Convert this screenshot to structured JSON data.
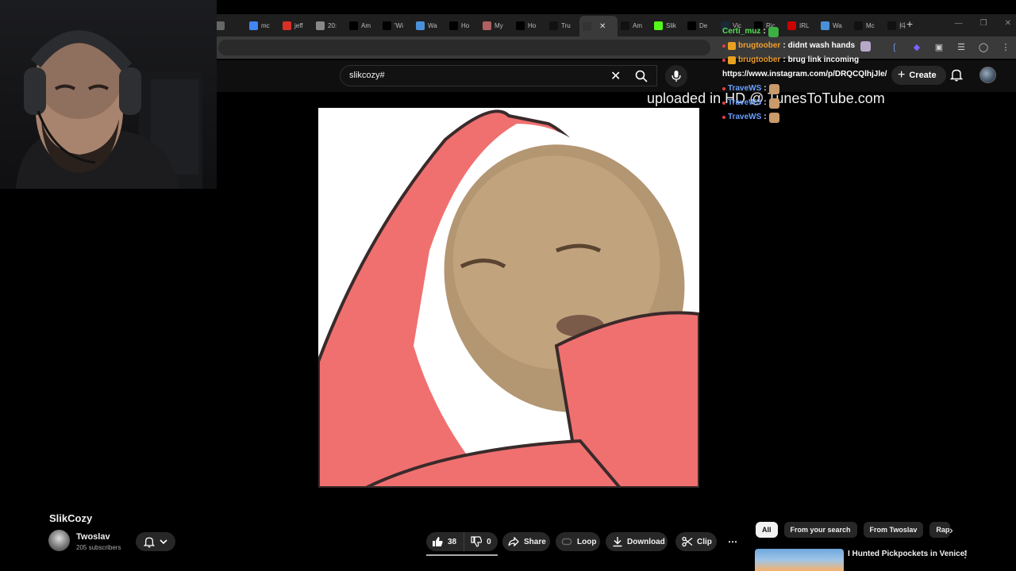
{
  "browser": {
    "tabs": [
      {
        "label": "",
        "color": "#666666"
      },
      {
        "label": "mc",
        "color": "#4285f4"
      },
      {
        "label": "jeff",
        "color": "#d93025"
      },
      {
        "label": "20:",
        "color": "#888888"
      },
      {
        "label": "Am",
        "color": "#000000"
      },
      {
        "label": "'Wi",
        "color": "#000000"
      },
      {
        "label": "Wa",
        "color": "#4a90d9"
      },
      {
        "label": "Ho",
        "color": "#000000"
      },
      {
        "label": "My",
        "color": "#b06060"
      },
      {
        "label": "Ho",
        "color": "#000000"
      },
      {
        "label": "Tru",
        "color": "#111111"
      },
      {
        "label": "",
        "color": "#333333",
        "active": true
      },
      {
        "label": "Am",
        "color": "#111111"
      },
      {
        "label": "Slik",
        "color": "#53fc18"
      },
      {
        "label": "De",
        "color": "#000000"
      },
      {
        "label": "Vic",
        "color": "#1b2838"
      },
      {
        "label": "Ric",
        "color": "#000000"
      },
      {
        "label": "IRL",
        "color": "#cc0000"
      },
      {
        "label": "Wa",
        "color": "#4a90d9"
      },
      {
        "label": "Mc",
        "color": "#111111"
      },
      {
        "label": "抖",
        "color": "#111111"
      }
    ],
    "new_tab": "+"
  },
  "search": {
    "value": "slikcozy#"
  },
  "masthead": {
    "create_label": "Create"
  },
  "video": {
    "watermark": "uploaded in HD @ TunesToTube.com"
  },
  "chat": {
    "messages": [
      {
        "user": "Certi_muz",
        "text": "",
        "user_color": "#55e055"
      },
      {
        "user": "brugtoober",
        "text": "didnt wash hands",
        "user_color": "#f0a030"
      },
      {
        "user": "brugtoober",
        "text": "brug link incoming",
        "user_color": "#f0a030"
      },
      {
        "user": "",
        "text": "https://www.instagram.com/p/DRQCQlhjJle/",
        "user_color": "#ffffff"
      },
      {
        "user": "TraveWS",
        "text": "",
        "user_color": "#6aa0ff"
      },
      {
        "user": "TraveWS",
        "text": "",
        "user_color": "#6aa0ff"
      },
      {
        "user": "TraveWS",
        "text": "",
        "user_color": "#6aa0ff"
      }
    ]
  },
  "watch": {
    "title": "SlikCozy",
    "channel": "Twoslav",
    "subscribers": "205 subscribers",
    "likes": "38",
    "dislikes": "0",
    "share_label": "Share",
    "loop_label": "Loop",
    "download_label": "Download",
    "clip_label": "Clip",
    "more_label": "⋯"
  },
  "chips": [
    "All",
    "From your search",
    "From Twoslav",
    "Rap"
  ],
  "recommendation": {
    "title": "I Hunted Pickpockets in Venice!"
  }
}
